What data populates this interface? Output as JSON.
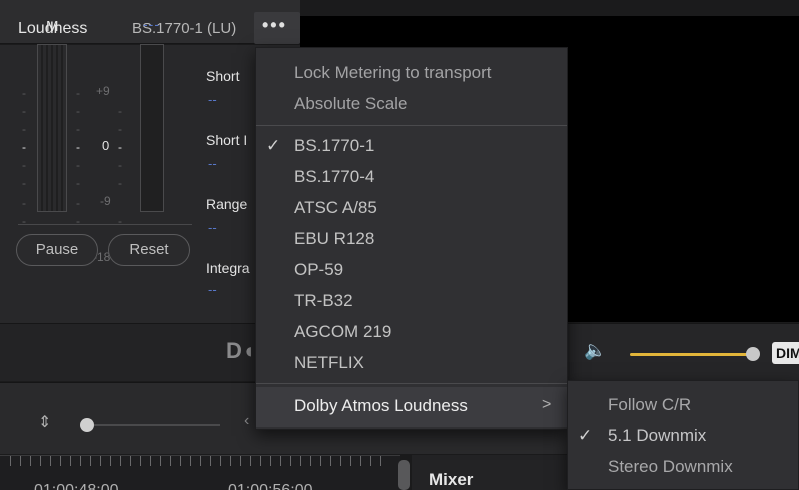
{
  "panel": {
    "title": "Loudness",
    "standard": "BS.1770-1 (LU)",
    "options_label": "•••"
  },
  "meter": {
    "m_label": "M",
    "short_placeholder": "---",
    "scale": [
      "+9",
      "0",
      "-9",
      "-18"
    ]
  },
  "stats": [
    {
      "label": "Short",
      "value": "--"
    },
    {
      "label": "Short I",
      "value": "--"
    },
    {
      "label": "Range",
      "value": "--"
    },
    {
      "label": "Integra",
      "value": "--"
    }
  ],
  "controls": {
    "pause_label": "Pause",
    "reset_label": "Reset"
  },
  "menu": {
    "top_items": [
      "Lock Metering to transport",
      "Absolute Scale"
    ],
    "standards": [
      "BS.1770-1",
      "BS.1770-4",
      "ATSC A/85",
      "EBU R128",
      "OP-59",
      "TR-B32",
      "AGCOM 219",
      "NETFLIX"
    ],
    "selected_standard": "BS.1770-1",
    "check_glyph": "✓",
    "submenu_label": "Dolby Atmos Loudness",
    "submenu_arrow": ">"
  },
  "submenu": {
    "items": [
      "Follow C/R",
      "5.1 Downmix",
      "Stereo Downmix"
    ],
    "selected": "5.1 Downmix"
  },
  "volume": {
    "dim_label": "DIM",
    "speaker_glyph": "🔈",
    "level": 0.95,
    "accent_color": "#e2b53a"
  },
  "timeline": {
    "timecodes": [
      "01:00:48:00",
      "01:00:56:00"
    ],
    "dolby_glyph": "D◖",
    "stepper_glyph": "⇕",
    "left_arrow": "‹"
  },
  "mixer": {
    "label": "Mixer"
  }
}
